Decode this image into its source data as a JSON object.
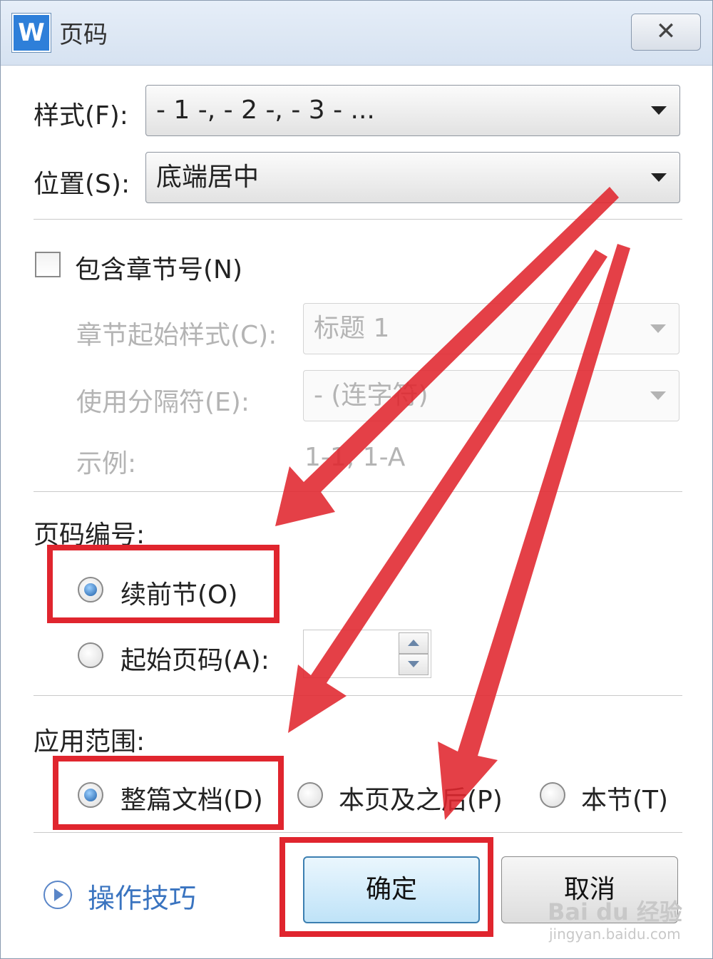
{
  "window": {
    "app_icon_letter": "W",
    "title": "页码",
    "close_glyph": "✕"
  },
  "style_field": {
    "label": "样式(F):",
    "value": "- 1 -, - 2 -, - 3 - ..."
  },
  "position_field": {
    "label": "位置(S):",
    "value": "底端居中"
  },
  "include_chapter": {
    "label": "包含章节号(N)",
    "checked": false,
    "chapter_style_label": "章节起始样式(C):",
    "chapter_style_value": "标题 1",
    "separator_label": "使用分隔符(E):",
    "separator_value": "-     (连字符)",
    "example_label": "示例:",
    "example_value": "1-1, 1-A"
  },
  "numbering": {
    "heading": "页码编号:",
    "continue_label": "续前节(O)",
    "continue_checked": true,
    "start_label": "起始页码(A):",
    "start_checked": false,
    "start_value": ""
  },
  "apply_scope": {
    "heading": "应用范围:",
    "options": [
      {
        "label": "整篇文档(D)",
        "checked": true
      },
      {
        "label": "本页及之后(P)",
        "checked": false
      },
      {
        "label": "本节(T)",
        "checked": false
      }
    ]
  },
  "footer": {
    "tips_label": "操作技巧",
    "ok_label": "确定",
    "cancel_label": "取消"
  },
  "watermark": {
    "brand": "Bai du 经验",
    "url": "jingyan.baidu.com"
  },
  "colors": {
    "annotation_red": "#e0252e",
    "accent_blue": "#3a74c0"
  }
}
